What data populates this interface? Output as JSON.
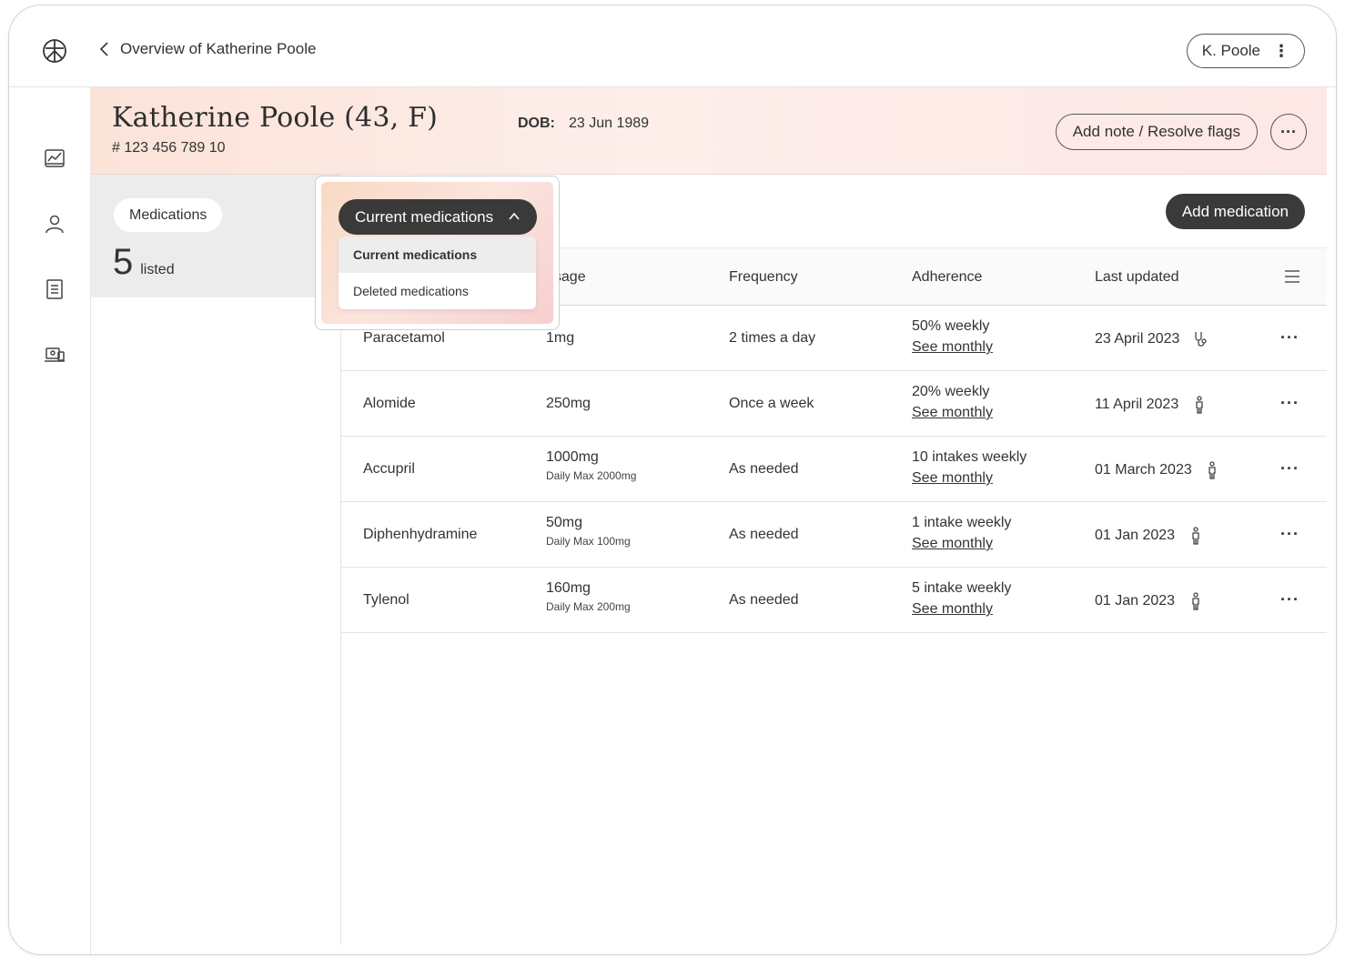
{
  "header": {
    "back_label": "Overview of Katherine Poole",
    "user_label": "K. Poole",
    "user_menu_icon": "vertical-ellipsis-icon"
  },
  "rail": {
    "items": [
      {
        "icon": "chart-icon"
      },
      {
        "icon": "person-icon"
      },
      {
        "icon": "document-icon"
      },
      {
        "icon": "devices-icon"
      }
    ]
  },
  "patient": {
    "name": "Katherine Poole (43, F)",
    "id": "# 123 456 789 10",
    "dob_label": "DOB:",
    "dob_value": "23 Jun 1989",
    "add_note_label": "Add note / Resolve flags",
    "more_label": "···"
  },
  "summary": {
    "chip_label": "Medications",
    "count": "5",
    "count_label": "listed"
  },
  "dropdown": {
    "selected": "Current medications",
    "options": [
      "Current medications",
      "Deleted medications"
    ]
  },
  "actions": {
    "add_medication_label": "Add medication"
  },
  "table": {
    "headers": [
      "Dosage",
      "Frequency",
      "Adherence",
      "Last updated"
    ],
    "dosage_header_visible": "osage",
    "rows": [
      {
        "name": "Paracetamol",
        "dosage": "1mg",
        "max": "",
        "frequency": "2 times a day",
        "adherence": "50% weekly",
        "link": "See monthly",
        "updated": "23 April 2023",
        "updated_icon": "stethoscope-icon"
      },
      {
        "name": "Alomide",
        "dosage": "250mg",
        "max": "",
        "frequency": "Once a week",
        "adherence": "20% weekly",
        "link": "See monthly",
        "updated": "11 April 2023",
        "updated_icon": "patient-icon"
      },
      {
        "name": "Accupril",
        "dosage": "1000mg",
        "max": "Daily Max 2000mg",
        "frequency": "As needed",
        "adherence": "10 intakes weekly",
        "link": "See monthly",
        "updated": "01 March 2023",
        "updated_icon": "patient-icon"
      },
      {
        "name": "Diphenhydramine",
        "dosage": "50mg",
        "max": "Daily Max 100mg",
        "frequency": "As needed",
        "adherence": "1 intake weekly",
        "link": "See monthly",
        "updated": "01 Jan 2023",
        "updated_icon": "patient-icon"
      },
      {
        "name": "Tylenol",
        "dosage": "160mg",
        "max": "Daily Max 200mg",
        "frequency": "As needed",
        "adherence": "5 intake weekly",
        "link": "See monthly",
        "updated": "01 Jan 2023",
        "updated_icon": "patient-icon"
      }
    ]
  },
  "colors": {
    "banner_start": "#fbe3d8",
    "banner_end": "#fde8e6",
    "dark_button": "#3a3a3a"
  }
}
